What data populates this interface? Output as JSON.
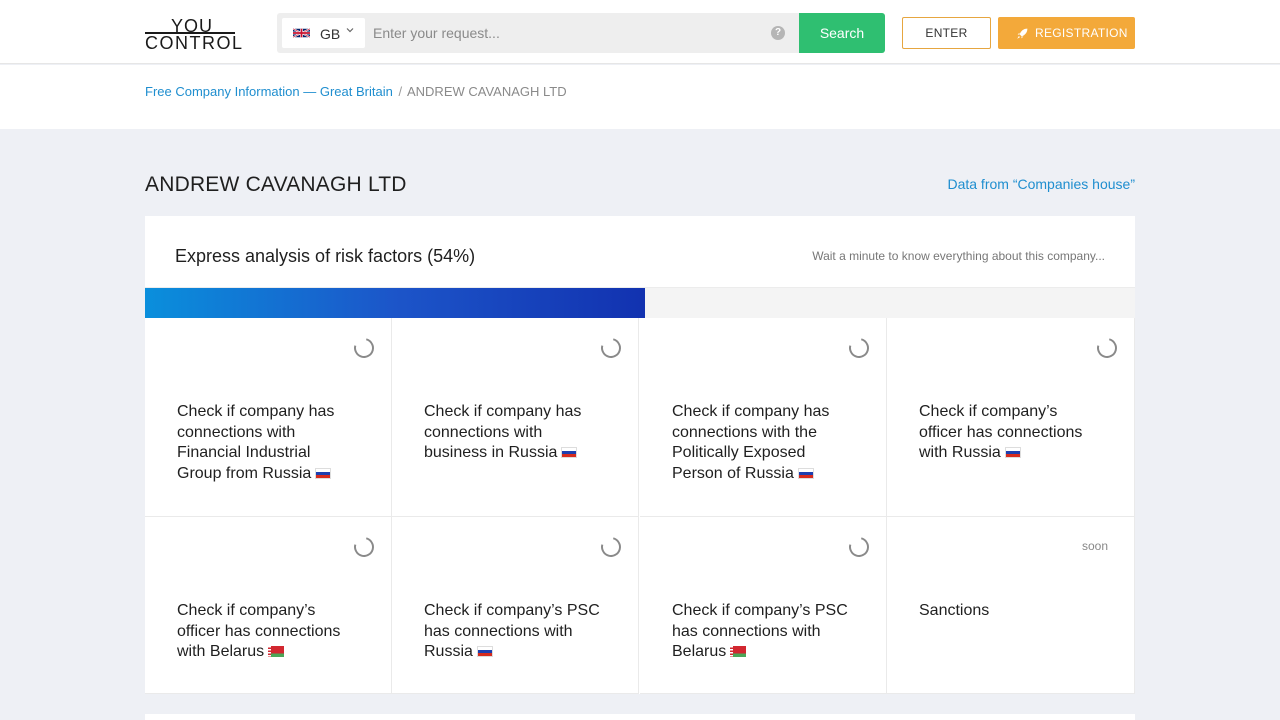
{
  "header": {
    "logo_top": "YOU",
    "logo_bottom": "CONTROL",
    "country_code": "GB",
    "search_placeholder": "Enter your request...",
    "help_label": "?",
    "search_button": "Search",
    "enter_button": "ENTER",
    "registration_button": "REGISTRATION"
  },
  "breadcrumb": {
    "link": "Free Company Information — Great Britain",
    "separator": "/",
    "current": "ANDREW CAVANAGH LTD"
  },
  "page": {
    "title": "ANDREW CAVANAGH LTD",
    "data_source": "Data from “Companies house”"
  },
  "risk": {
    "title": "Express analysis of risk factors (54%)",
    "subtitle": "Wait a minute to know everything about this company...",
    "progress_fraction": 0.505,
    "cells": [
      {
        "text": "Check if company has connections with Financial Industrial Group from Russia",
        "flag": "ru",
        "status": "loading"
      },
      {
        "text": "Check if company has connections with business in Russia",
        "flag": "ru",
        "status": "loading"
      },
      {
        "text": "Check if company has connections with the Politically Exposed Person of Russia",
        "flag": "ru",
        "status": "loading"
      },
      {
        "text": "Check if company’s officer has connections with Russia",
        "flag": "ru",
        "status": "loading"
      },
      {
        "text": "Check if company’s officer has connections with Belarus",
        "flag": "by",
        "status": "loading"
      },
      {
        "text": "Check if company’s PSC has connections with Russia",
        "flag": "ru",
        "status": "loading"
      },
      {
        "text": "Check if company’s PSC has connections with Belarus",
        "flag": "by",
        "status": "loading"
      },
      {
        "text": "Sanctions",
        "flag": "",
        "status": "soon",
        "status_label": "soon"
      }
    ]
  },
  "colors": {
    "accent_blue": "#1f8ecf",
    "search_green": "#2fbf71",
    "registration_orange": "#f3a93a",
    "progress_start": "#0a8fdc",
    "progress_end": "#1232b0"
  }
}
